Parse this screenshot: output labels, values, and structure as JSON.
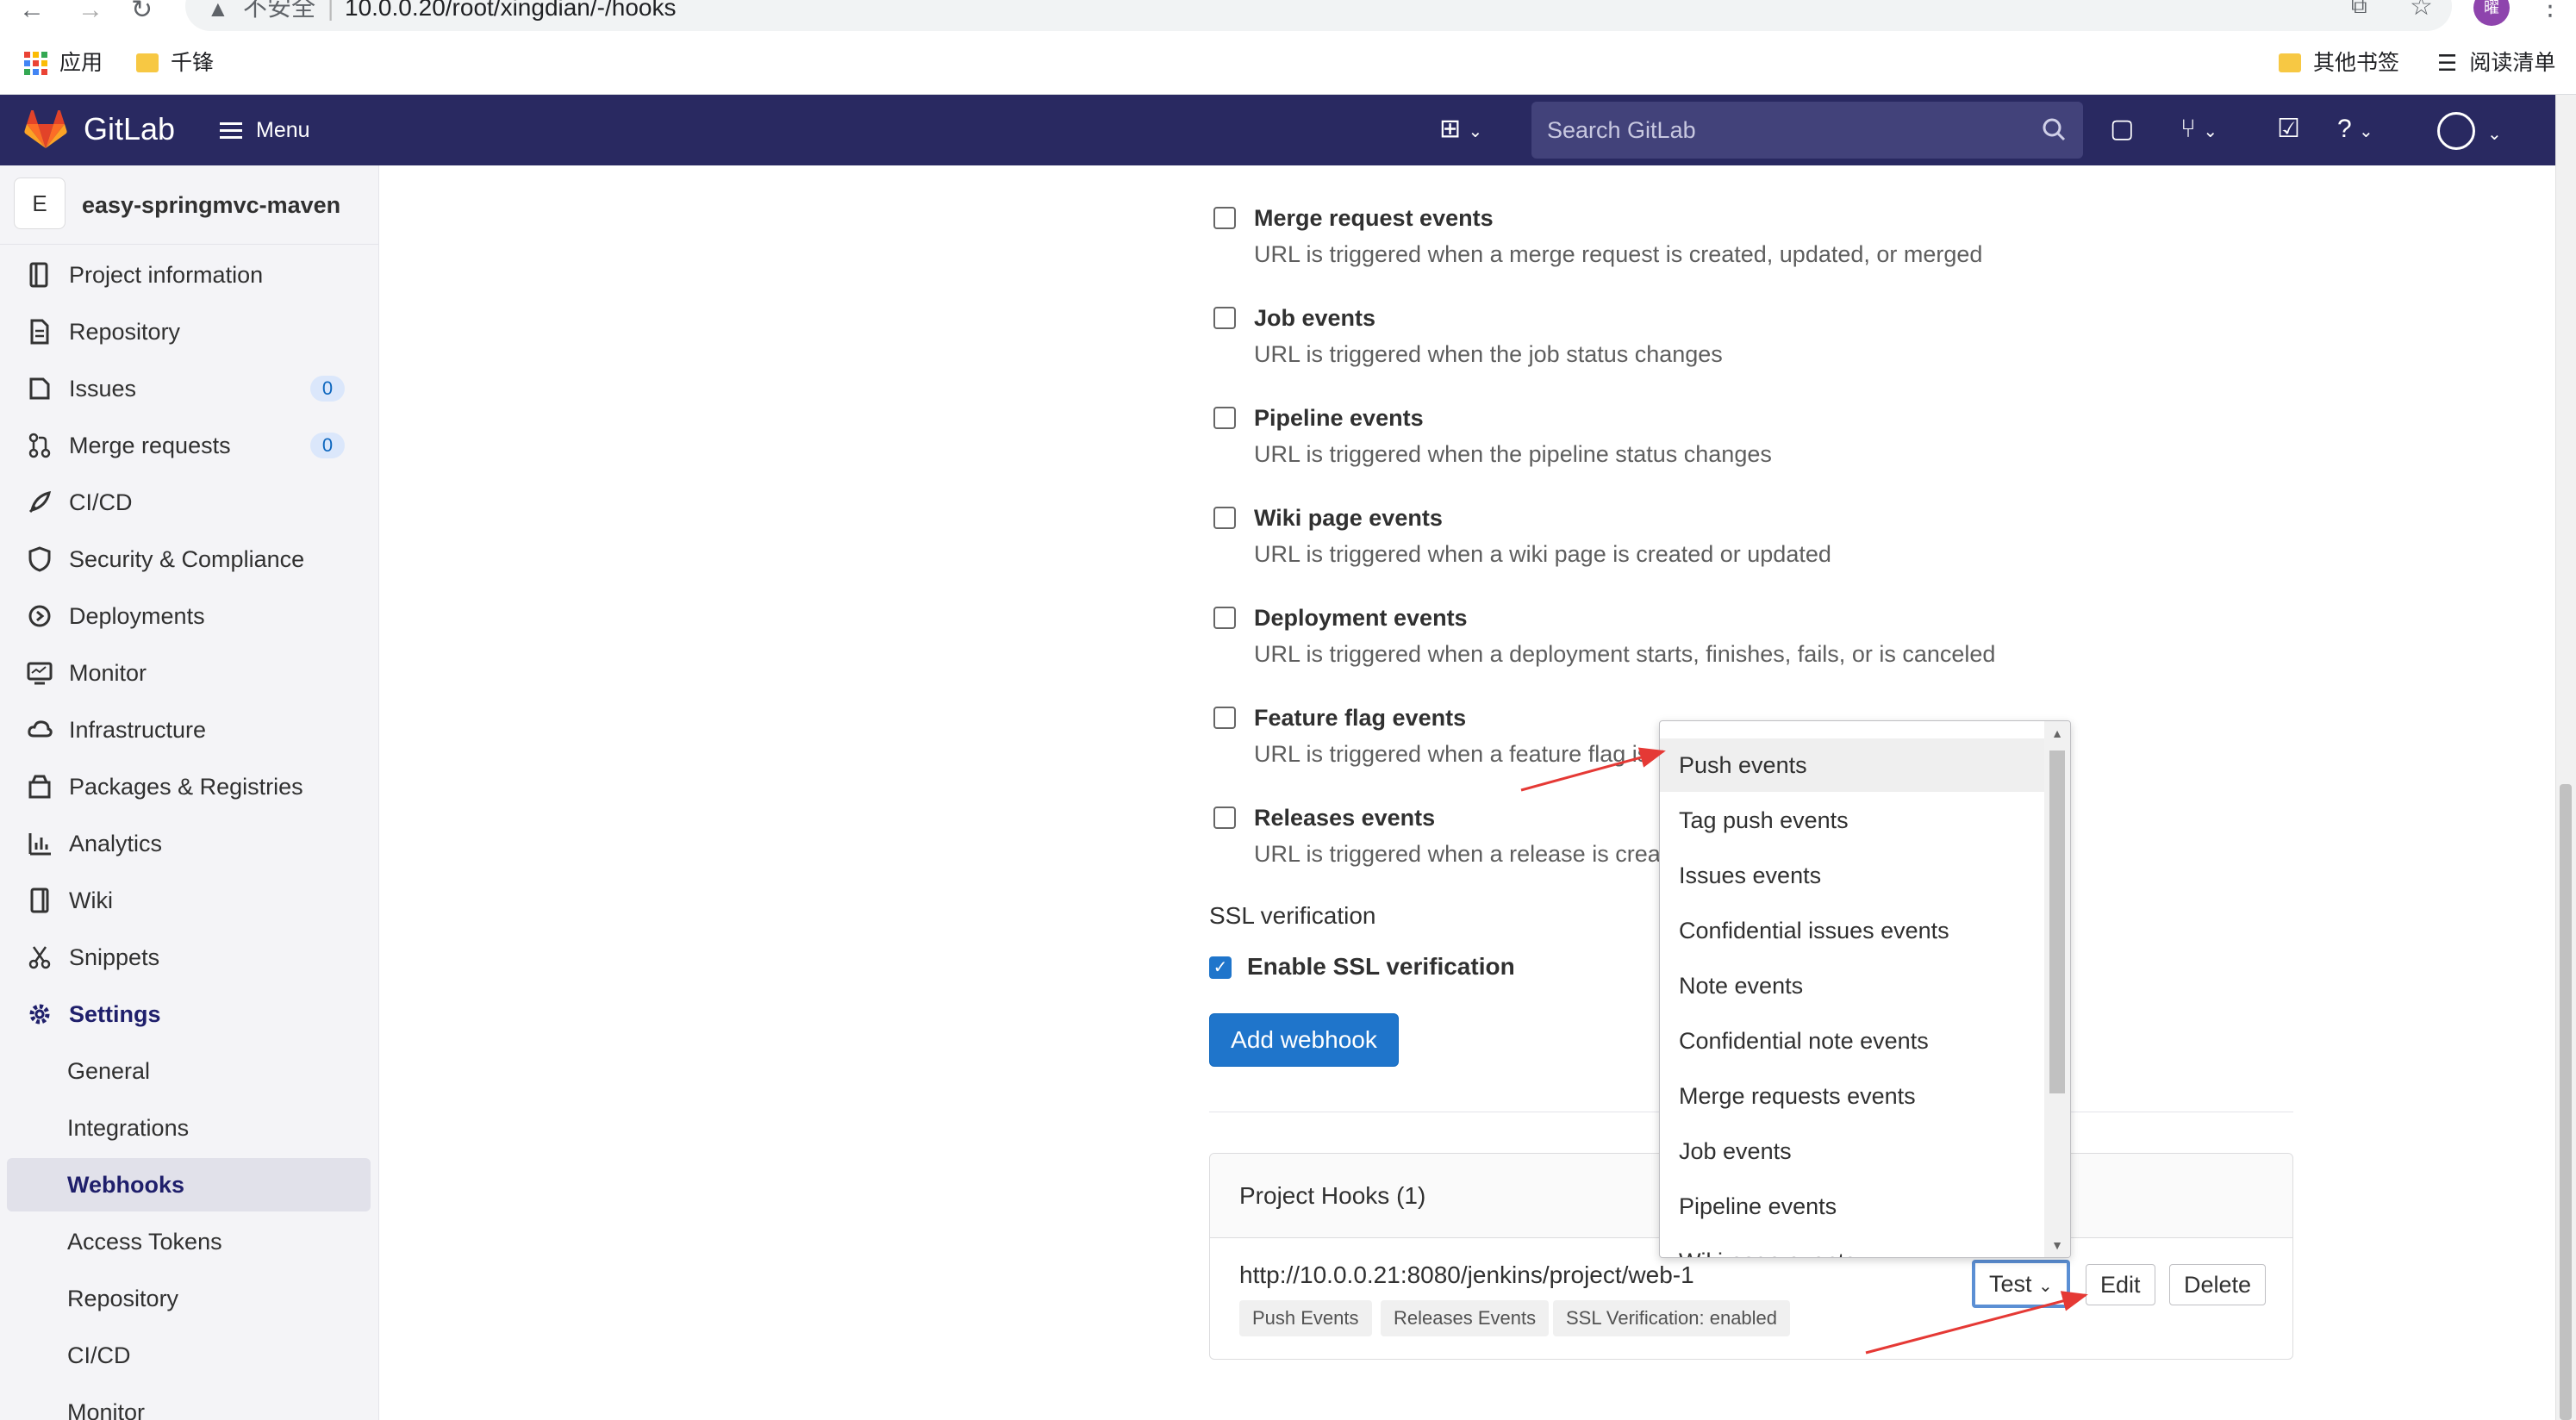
{
  "browser": {
    "insecure_label": "不安全",
    "url": "10.0.0.20/root/xingdian/-/hooks",
    "profile_initial": "曜",
    "bookmarks": {
      "apps": "应用",
      "folder1": "千锋",
      "other": "其他书签",
      "reading_list": "阅读清单"
    }
  },
  "header": {
    "brand": "GitLab",
    "menu_label": "Menu",
    "search_placeholder": "Search GitLab"
  },
  "sidebar": {
    "project_initial": "E",
    "project_name": "easy-springmvc-maven",
    "items": [
      {
        "label": "Project information",
        "icon": "project-icon"
      },
      {
        "label": "Repository",
        "icon": "document-icon"
      },
      {
        "label": "Issues",
        "icon": "issues-icon",
        "badge": "0"
      },
      {
        "label": "Merge requests",
        "icon": "merge-request-icon",
        "badge": "0"
      },
      {
        "label": "CI/CD",
        "icon": "rocket-icon"
      },
      {
        "label": "Security & Compliance",
        "icon": "shield-icon"
      },
      {
        "label": "Deployments",
        "icon": "deployments-icon"
      },
      {
        "label": "Monitor",
        "icon": "monitor-icon"
      },
      {
        "label": "Infrastructure",
        "icon": "cloud-icon"
      },
      {
        "label": "Packages & Registries",
        "icon": "package-icon"
      },
      {
        "label": "Analytics",
        "icon": "chart-icon"
      },
      {
        "label": "Wiki",
        "icon": "book-icon"
      },
      {
        "label": "Snippets",
        "icon": "scissors-icon"
      },
      {
        "label": "Settings",
        "icon": "gear-icon"
      }
    ],
    "settings_sub": [
      "General",
      "Integrations",
      "Webhooks",
      "Access Tokens",
      "Repository",
      "CI/CD",
      "Monitor"
    ]
  },
  "events": [
    {
      "title": "Merge request events",
      "desc": "URL is triggered when a merge request is created, updated, or merged"
    },
    {
      "title": "Job events",
      "desc": "URL is triggered when the job status changes"
    },
    {
      "title": "Pipeline events",
      "desc": "URL is triggered when the pipeline status changes"
    },
    {
      "title": "Wiki page events",
      "desc": "URL is triggered when a wiki page is created or updated"
    },
    {
      "title": "Deployment events",
      "desc": "URL is triggered when a deployment starts, finishes, fails, or is canceled"
    },
    {
      "title": "Feature flag events",
      "desc": "URL is triggered when a feature flag is"
    },
    {
      "title": "Releases events",
      "desc": "URL is triggered when a release is crea"
    }
  ],
  "ssl": {
    "label": "SSL verification",
    "checkbox_label": "Enable SSL verification",
    "checked": true
  },
  "add_webhook_label": "Add webhook",
  "hooks": {
    "title": "Project Hooks (1)",
    "url": "http://10.0.0.21:8080/jenkins/project/web-1",
    "tags": [
      "Push Events",
      "Releases Events",
      "SSL Verification: enabled"
    ],
    "test_label": "Test",
    "edit_label": "Edit",
    "delete_label": "Delete"
  },
  "dropdown": {
    "options": [
      "Push events",
      "Tag push events",
      "Issues events",
      "Confidential issues events",
      "Note events",
      "Confidential note events",
      "Merge requests events",
      "Job events",
      "Pipeline events",
      "Wiki page events"
    ],
    "highlighted": "Push events"
  },
  "colors": {
    "header_bg": "#292961",
    "primary_button": "#1f75cb",
    "annotation_arrow": "#e53935"
  }
}
